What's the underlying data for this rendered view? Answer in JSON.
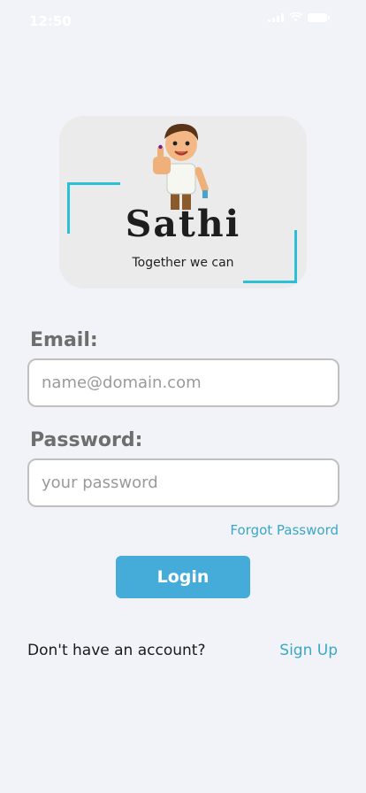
{
  "status_bar": {
    "time": "12:50"
  },
  "logo": {
    "brand_name": "Sathi",
    "tagline": "Together we can",
    "accent_color": "#2bbfd8"
  },
  "form": {
    "email_label": "Email:",
    "email_placeholder": "name@domain.com",
    "email_value": "",
    "password_label": "Password:",
    "password_placeholder": "your password",
    "password_value": "",
    "forgot_password": "Forgot Password",
    "login_button": "Login"
  },
  "footer": {
    "no_account_text": "Don't have an account?",
    "signup_link": "Sign Up"
  },
  "colors": {
    "background": "#f2f3f8",
    "primary": "#45acd9",
    "link": "#3aa7c8"
  }
}
